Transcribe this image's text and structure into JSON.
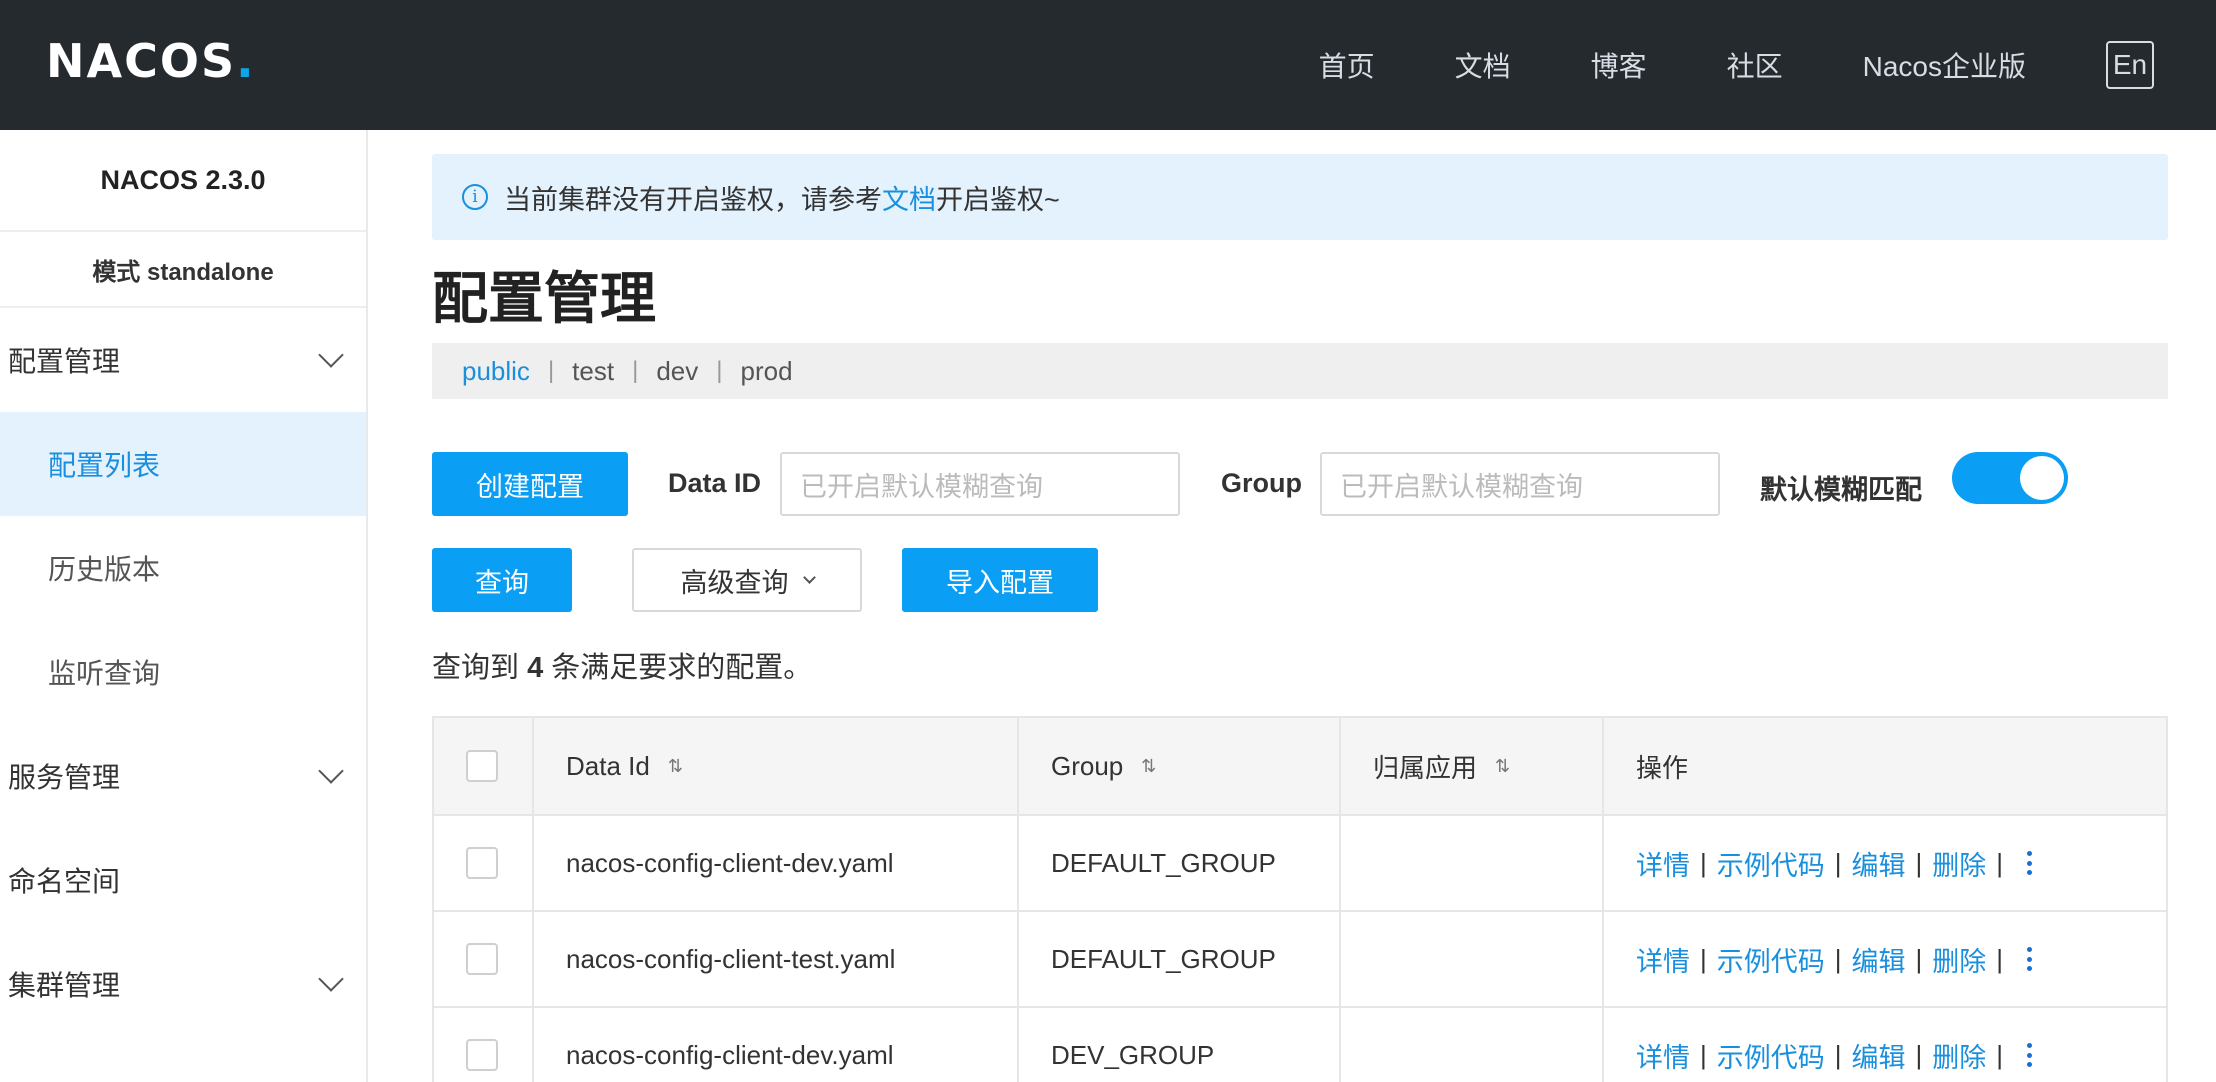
{
  "header": {
    "logo": "NACOS.",
    "nav": [
      "首页",
      "文档",
      "博客",
      "社区",
      "Nacos企业版"
    ],
    "lang": "En"
  },
  "sidebar": {
    "version": "NACOS 2.3.0",
    "mode": "模式 standalone",
    "groups": [
      {
        "label": "配置管理",
        "items": [
          "配置列表",
          "历史版本",
          "监听查询"
        ]
      },
      {
        "label": "服务管理"
      },
      {
        "label": "命名空间"
      },
      {
        "label": "集群管理"
      }
    ],
    "active_item": "配置列表"
  },
  "notice": {
    "prefix": "当前集群没有开启鉴权，请参考",
    "link": "文档",
    "suffix": "开启鉴权~"
  },
  "page_title": "配置管理",
  "namespaces": [
    "public",
    "test",
    "dev",
    "prod"
  ],
  "active_namespace": "public",
  "search": {
    "create_btn": "创建配置",
    "data_id_label": "Data ID",
    "data_id_placeholder": "已开启默认模糊查询",
    "group_label": "Group",
    "group_placeholder": "已开启默认模糊查询",
    "fuzzy_label": "默认模糊匹配",
    "fuzzy_on": true,
    "query_btn": "查询",
    "advanced_btn": "高级查询",
    "import_btn": "导入配置"
  },
  "result": {
    "prefix": "查询到",
    "count": "4",
    "suffix": "条满足要求的配置。"
  },
  "table": {
    "headers": [
      "Data Id",
      "Group",
      "归属应用",
      "操作"
    ],
    "rows": [
      {
        "data_id": "nacos-config-client-dev.yaml",
        "group": "DEFAULT_GROUP",
        "app": ""
      },
      {
        "data_id": "nacos-config-client-test.yaml",
        "group": "DEFAULT_GROUP",
        "app": ""
      },
      {
        "data_id": "nacos-config-client-dev.yaml",
        "group": "DEV_GROUP",
        "app": ""
      }
    ],
    "ops": [
      "详情",
      "示例代码",
      "编辑",
      "删除"
    ]
  },
  "colors": {
    "header_bg": "#252a2f",
    "accent": "#0a9ef5",
    "link": "#1a8fdd",
    "active_bg": "#e3f2fd"
  }
}
